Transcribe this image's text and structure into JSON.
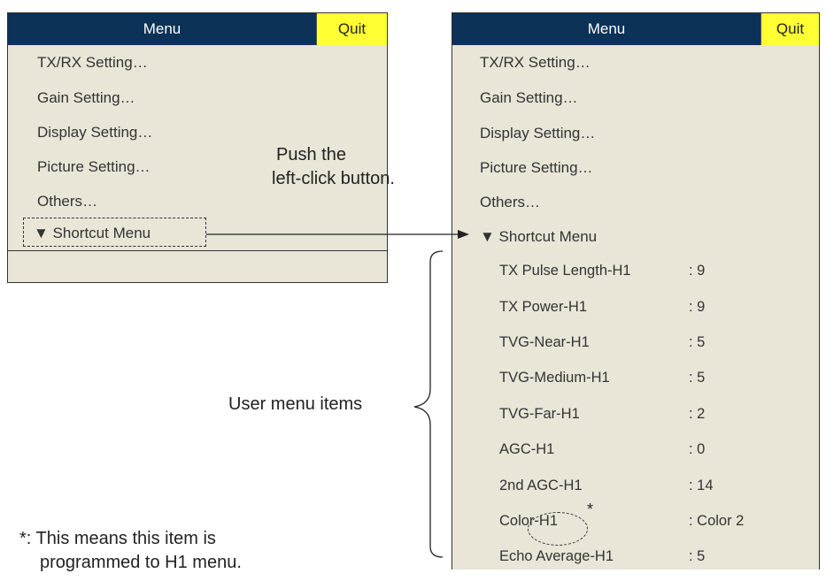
{
  "left_menu": {
    "title": "Menu",
    "quit_label": "Quit",
    "items": [
      "TX/RX Setting…",
      "Gain Setting…",
      "Display Setting…",
      "Picture Setting…",
      "Others…"
    ],
    "shortcut_label": "▼ Shortcut Menu"
  },
  "right_menu": {
    "title": "Menu",
    "quit_label": "Quit",
    "items": [
      "TX/RX Setting…",
      "Gain Setting…",
      "Display Setting…",
      "Picture Setting…",
      "Others…"
    ],
    "shortcut_label": "▼ Shortcut Menu",
    "shortcut_items": [
      {
        "label": "TX Pulse Length-H1",
        "value": ": 9"
      },
      {
        "label": "TX Power-H1",
        "value": ": 9"
      },
      {
        "label": "TVG-Near-H1",
        "value": ": 5"
      },
      {
        "label": "TVG-Medium-H1",
        "value": ": 5"
      },
      {
        "label": "TVG-Far-H1",
        "value": ": 2"
      },
      {
        "label": "AGC-H1",
        "value": ": 0"
      },
      {
        "label": "2nd AGC-H1",
        "value": ": 14"
      },
      {
        "label": "Color-H1",
        "value": ": Color 2"
      },
      {
        "label": "Echo Average-H1",
        "value": ": 5"
      }
    ]
  },
  "annotations": {
    "push_line1": "Push the",
    "push_line2": "left-click button.",
    "user_menu_items": "User menu items",
    "asterisk": "*",
    "footnote_line1": "*: This means this item is",
    "footnote_line2": "programmed to H1 menu."
  }
}
